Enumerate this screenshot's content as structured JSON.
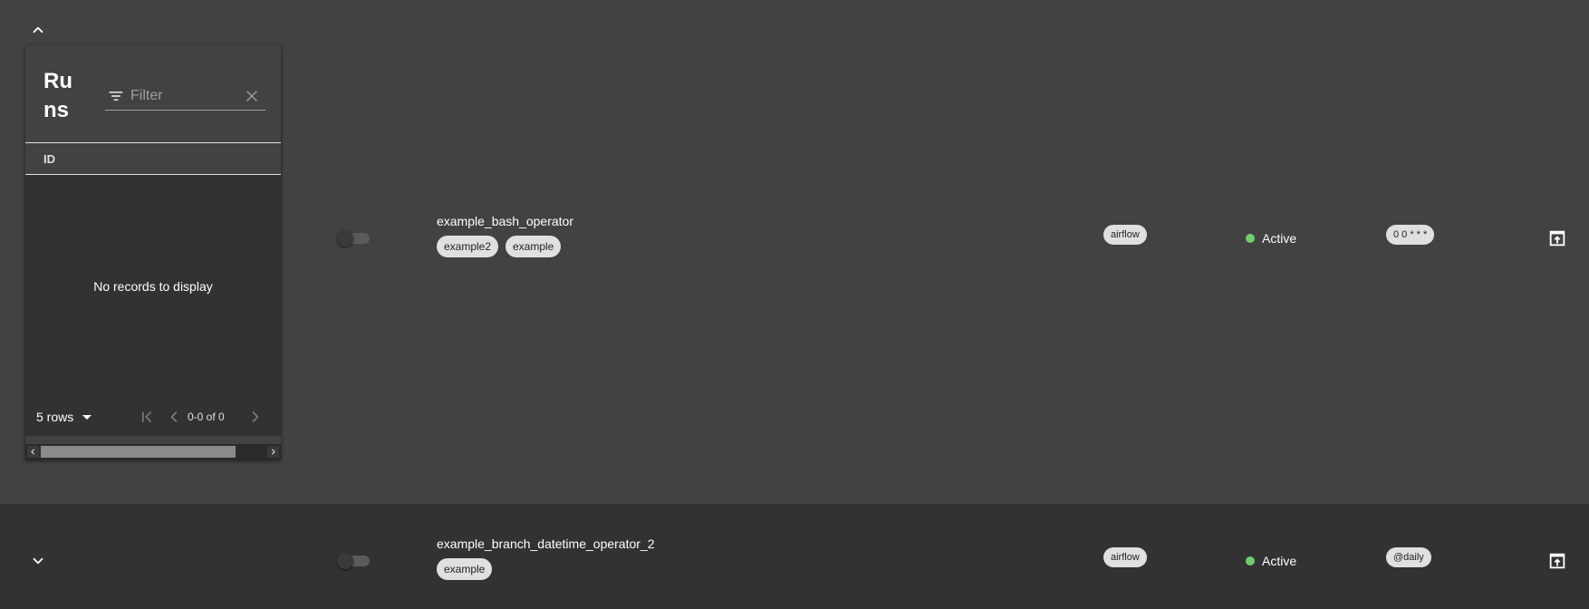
{
  "runs_panel": {
    "title": "Runs",
    "filter_placeholder": "Filter",
    "filter_value": "",
    "column_header": "ID",
    "empty_message": "No records to display",
    "rows_per_page": "5 rows",
    "page_info": "0-0 of 0"
  },
  "dags": [
    {
      "name": "example_bash_operator",
      "tags": [
        "example2",
        "example"
      ],
      "owner": "airflow",
      "status": "Active",
      "schedule": "0 0 * * *",
      "expanded": true,
      "paused": true
    },
    {
      "name": "example_branch_datetime_operator_2",
      "tags": [
        "example"
      ],
      "owner": "airflow",
      "status": "Active",
      "schedule": "@daily",
      "expanded": false,
      "paused": true
    }
  ],
  "colors": {
    "background": "#424242",
    "row_alt": "#323232",
    "chip": "#e0e0e0",
    "status_active": "#6fcf6f"
  }
}
